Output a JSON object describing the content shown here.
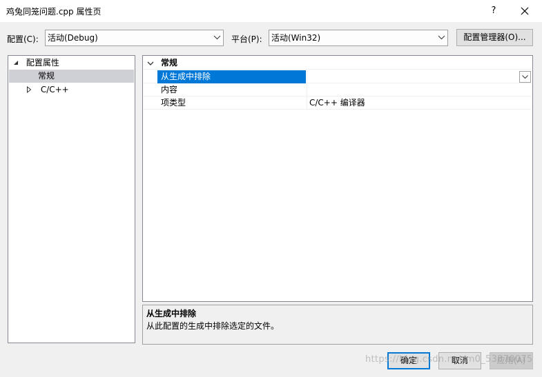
{
  "window": {
    "title": "鸡兔同笼问题.cpp 属性页",
    "help_label": "?",
    "close_icon": "close-icon"
  },
  "config": {
    "config_label": "配置(C):",
    "config_value": "活动(Debug)",
    "platform_label": "平台(P):",
    "platform_value": "活动(Win32)",
    "manager_button": "配置管理器(O)..."
  },
  "tree": {
    "root": "配置属性",
    "items": [
      "常规",
      "C/C++"
    ],
    "selected": "常规"
  },
  "grid": {
    "category": "常规",
    "rows": [
      {
        "name": "从生成中排除",
        "value": "",
        "selected": true
      },
      {
        "name": "内容",
        "value": ""
      },
      {
        "name": "项类型",
        "value": "C/C++ 编译器"
      }
    ]
  },
  "description": {
    "title": "从生成中排除",
    "text": "从此配置的生成中排除选定的文件。"
  },
  "buttons": {
    "ok": "确定",
    "cancel": "取消",
    "apply": "应用(A)"
  },
  "watermark": "https://blog.csdn.net/m0_53870075",
  "colors": {
    "selection": "#0078d7",
    "tree_selection": "#cfcfd6",
    "window_bg": "#f0f0f0",
    "ok_border": "#0078d7"
  }
}
